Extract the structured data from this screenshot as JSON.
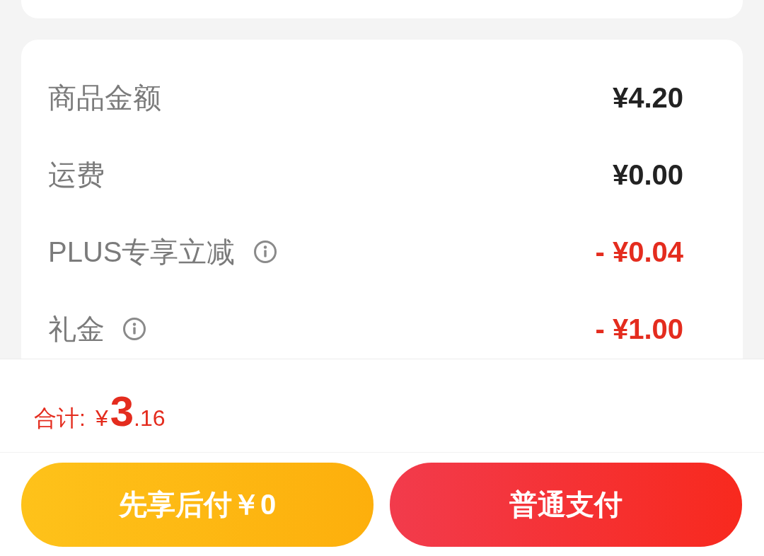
{
  "price_details": [
    {
      "label": "商品金额",
      "value": "¥4.20",
      "kind": "charge",
      "info": false
    },
    {
      "label": "运费",
      "value": "¥0.00",
      "kind": "charge",
      "info": false
    },
    {
      "label": "PLUS专享立减",
      "value": "- ¥0.04",
      "kind": "discount",
      "info": true
    },
    {
      "label": "礼金",
      "value": "- ¥1.00",
      "kind": "discount",
      "info": true
    }
  ],
  "total": {
    "label": "合计:",
    "currency": "¥",
    "integer": "3",
    "decimal": ".16"
  },
  "buttons": [
    {
      "label": "先享后付￥0",
      "kind": "pay_later"
    },
    {
      "label": "普通支付",
      "kind": "pay_now"
    }
  ]
}
